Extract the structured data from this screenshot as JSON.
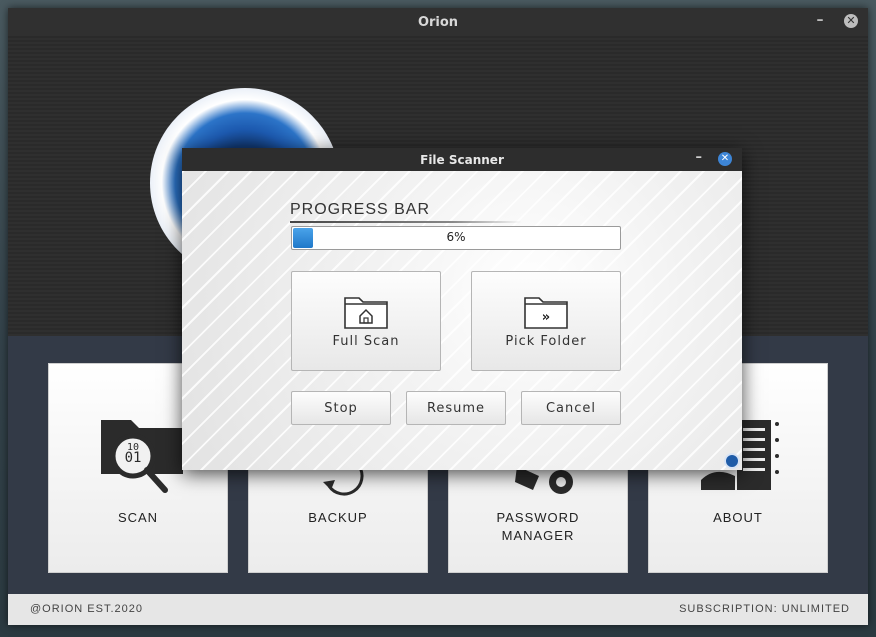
{
  "main_window": {
    "title": "Orion",
    "minimize_glyph": "–",
    "close_glyph": "✕"
  },
  "tiles": [
    {
      "label": "SCAN",
      "icon": "scan-folder-icon"
    },
    {
      "label": "BACKUP",
      "icon": "backup-icon"
    },
    {
      "label": "PASSWORD\nMANAGER",
      "icon": "password-manager-icon"
    },
    {
      "label": "ABOUT",
      "icon": "about-icon"
    }
  ],
  "footer": {
    "left": "@ORION EST.2020",
    "right": "SUBSCRIPTION: UNLIMITED"
  },
  "dialog": {
    "title": "File Scanner",
    "minimize_glyph": "–",
    "close_glyph": "✕",
    "progress_heading": "PROGRESS BAR",
    "progress_value": 6,
    "progress_text": "6%",
    "buttons": {
      "full_scan": "Full Scan",
      "pick_folder": "Pick Folder",
      "stop": "Stop",
      "resume": "Resume",
      "cancel": "Cancel"
    }
  },
  "colors": {
    "accent": "#2a7fd0",
    "dialog_title_bg": "#2d2d2d",
    "panel_bg": "#333a47"
  }
}
